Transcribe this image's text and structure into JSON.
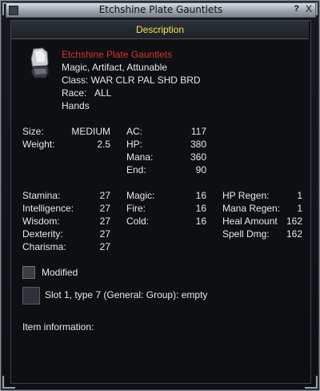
{
  "window": {
    "title": "Etchshine Plate Gauntlets",
    "help_label": "?",
    "close_label": "X"
  },
  "section": {
    "title": "Description"
  },
  "item": {
    "icon": "gauntlets-icon",
    "name": "Etchshine Plate Gauntlets",
    "flags": "Magic, Artifact, Attunable",
    "class_line": "Class: WAR CLR PAL SHD BRD",
    "race_label": "Race:",
    "race_value": "ALL",
    "slot_line": "Hands"
  },
  "basic": {
    "size_label": "Size:",
    "size_value": "MEDIUM",
    "weight_label": "Weight:",
    "weight_value": "2.5",
    "ac_label": "AC:",
    "ac_value": "117",
    "hp_label": "HP:",
    "hp_value": "380",
    "mana_label": "Mana:",
    "mana_value": "360",
    "end_label": "End:",
    "end_value": "90"
  },
  "stats": [
    {
      "label": "Stamina:",
      "value": "27"
    },
    {
      "label": "Intelligence:",
      "value": "27"
    },
    {
      "label": "Wisdom:",
      "value": "27"
    },
    {
      "label": "Dexterity:",
      "value": "27"
    },
    {
      "label": "Charisma:",
      "value": "27"
    }
  ],
  "resists": [
    {
      "label": "Magic:",
      "value": "16"
    },
    {
      "label": "Fire:",
      "value": "16"
    },
    {
      "label": "Cold:",
      "value": "16"
    }
  ],
  "mods": [
    {
      "label": "HP Regen:",
      "value": "1"
    },
    {
      "label": "Mana Regen:",
      "value": "1"
    },
    {
      "label": "Heal Amount",
      "value": "162"
    },
    {
      "label": "Spell Dmg:",
      "value": "162"
    }
  ],
  "modified_label": "Modified",
  "aug_slot": "Slot 1, type 7 (General: Group): empty",
  "item_info_label": "Item information:",
  "colors": {
    "title_yellow": "#f2e24a",
    "item_red": "#d8342c",
    "text": "#e8e8e8"
  }
}
